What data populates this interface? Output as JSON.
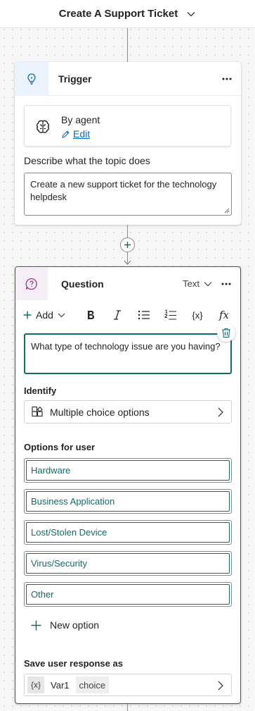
{
  "header": {
    "title": "Create A Support Ticket"
  },
  "trigger": {
    "title": "Trigger",
    "agent_label": "By agent",
    "edit_label": "Edit",
    "description_label": "Describe what the topic does",
    "description_value": "Create a new support ticket for the technology helpdesk"
  },
  "question": {
    "title": "Question",
    "response_type": "Text",
    "toolbar": {
      "add_label": "Add",
      "variable_label": "{x}",
      "formula_label": "fx"
    },
    "prompt": "What type of technology issue are you having?",
    "identify_label": "Identify",
    "identify_value": "Multiple choice options",
    "options_label": "Options for user",
    "options": [
      {
        "label": "Hardware"
      },
      {
        "label": "Business Application"
      },
      {
        "label": "Lost/Stolen Device"
      },
      {
        "label": "Virus/Security"
      },
      {
        "label": "Other"
      }
    ],
    "new_option_label": "New option",
    "save_label": "Save user response as",
    "save_var_icon": "{x}",
    "save_var_name": "Var1",
    "save_var_type": "choice"
  },
  "colors": {
    "accent_teal": "#0f6c6c",
    "link_blue": "#0f6cbd",
    "trigger_tile": "#eaf3fb",
    "question_tile": "#f6eef6"
  },
  "icons": {
    "trigger": "lightbulb-icon",
    "agent": "brain-icon",
    "question": "question-bubble-icon",
    "identify": "choice-grid-icon",
    "delete": "trash-icon"
  }
}
